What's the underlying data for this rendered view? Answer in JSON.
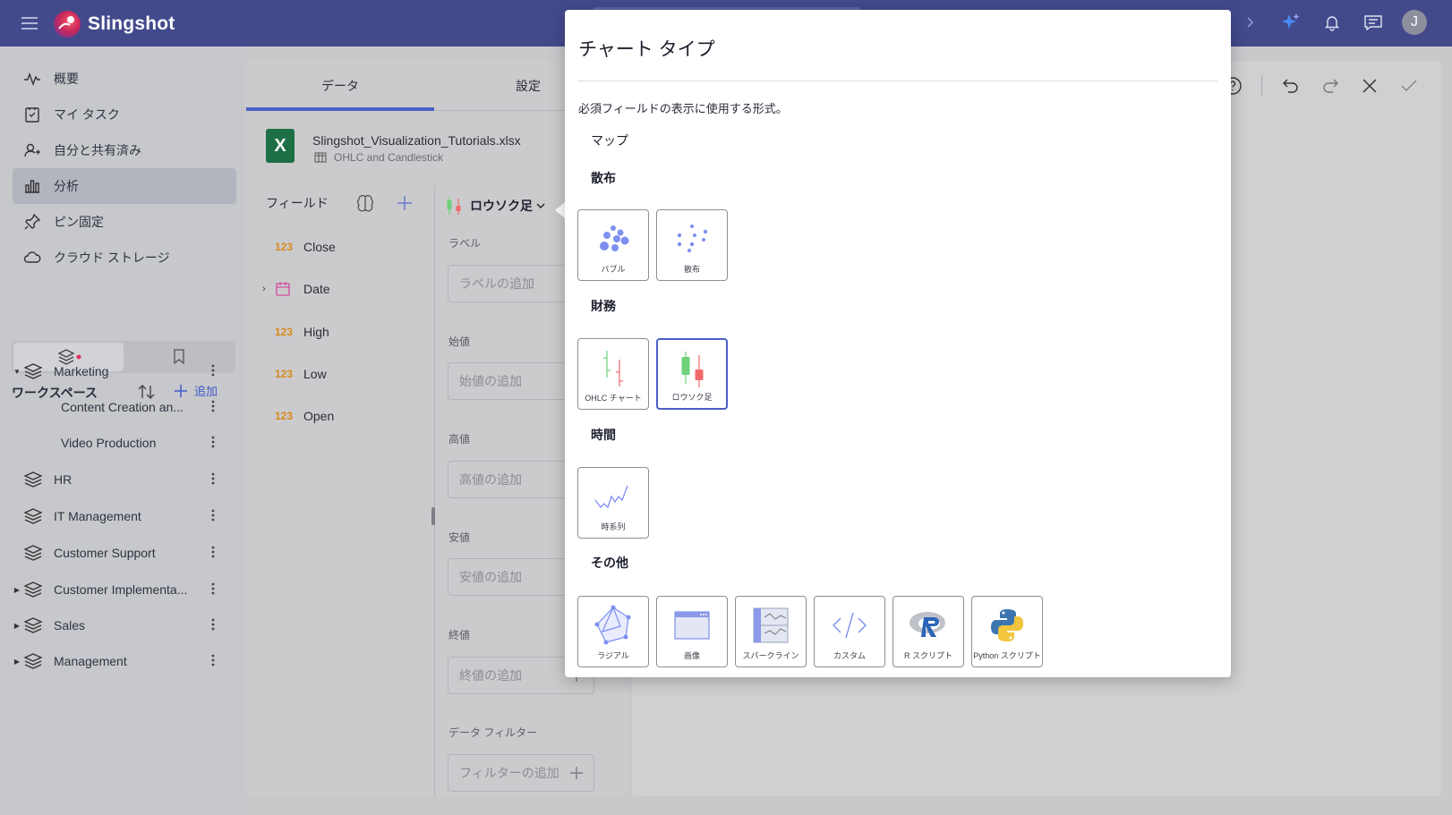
{
  "app": {
    "name": "Slingshot",
    "user_initial": "J"
  },
  "sidebar": {
    "nav": [
      {
        "label": "概要",
        "icon": "pulse-icon"
      },
      {
        "label": "マイ タスク",
        "icon": "task-check-icon"
      },
      {
        "label": "自分と共有済み",
        "icon": "shared-user-icon"
      },
      {
        "label": "分析",
        "icon": "bar-chart-icon"
      },
      {
        "label": "ピン固定",
        "icon": "pin-icon"
      },
      {
        "label": "クラウド ストレージ",
        "icon": "cloud-icon"
      }
    ],
    "workspaces_title": "ワークスペース",
    "add_label": "追加",
    "workspaces": [
      {
        "label": "Marketing"
      },
      {
        "label": "Content Creation an..."
      },
      {
        "label": "Video Production"
      },
      {
        "label": "HR"
      },
      {
        "label": "IT Management"
      },
      {
        "label": "Customer Support"
      },
      {
        "label": "Customer Implementa..."
      },
      {
        "label": "Sales"
      },
      {
        "label": "Management"
      }
    ]
  },
  "editor": {
    "tabs": [
      "データ",
      "設定"
    ],
    "file_name": "Slingshot_Visualization_Tutorials.xlsx",
    "sheet_name": "OHLC and Candlestick",
    "fields_title": "フィールド",
    "fields": [
      {
        "type": "123",
        "name": "Close"
      },
      {
        "type": "date",
        "name": "Date"
      },
      {
        "type": "123",
        "name": "High"
      },
      {
        "type": "123",
        "name": "Low"
      },
      {
        "type": "123",
        "name": "Open"
      }
    ],
    "chart_type_label": "ロウソク足",
    "slots": [
      {
        "label": "ラベル",
        "placeholder": "ラベルの追加"
      },
      {
        "label": "始値",
        "placeholder": "始値の追加"
      },
      {
        "label": "高値",
        "placeholder": "高値の追加"
      },
      {
        "label": "安値",
        "placeholder": "安値の追加"
      },
      {
        "label": "終値",
        "placeholder": "終値の追加"
      },
      {
        "label": "データ フィルター",
        "placeholder": "フィルターの追加"
      }
    ]
  },
  "dialog": {
    "title": "チャート タイプ",
    "description": "必須フィールドの表示に使用する形式。",
    "groups": {
      "map": "マップ",
      "scatter": "散布",
      "finance": "財務",
      "time": "時間",
      "other": "その他"
    },
    "tiles": {
      "bubble": "バブル",
      "scatter": "散布",
      "ohlc": "OHLC チャート",
      "candlestick": "ロウソク足",
      "timeseries": "時系列",
      "radial": "ラジアル",
      "image": "画像",
      "sparkline": "スパークライン",
      "custom": "カスタム",
      "rscript": "R スクリプト",
      "python": "Python スクリプト"
    },
    "selected": "candlestick"
  },
  "colors": {
    "topbar": "#434a8c",
    "accent": "#4a5fc6",
    "candle_up": "#6fd07a",
    "candle_down": "#f06a6a",
    "number_type": "#d8891b"
  }
}
